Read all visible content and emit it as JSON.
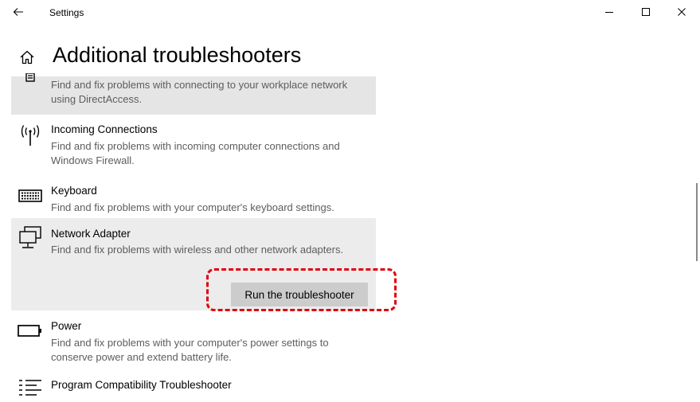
{
  "window": {
    "app_title": "Settings",
    "back_icon": "arrow-left-icon",
    "minimize_icon": "minimize-icon",
    "maximize_icon": "maximize-icon",
    "close_icon": "close-icon"
  },
  "header": {
    "home_icon": "home-icon",
    "page_title": "Additional troubleshooters"
  },
  "troubleshooters": [
    {
      "icon": "directaccess-icon",
      "title": "",
      "description": "Find and fix problems with connecting to your workplace network using DirectAccess.",
      "state": "hover"
    },
    {
      "icon": "antenna-icon",
      "title": "Incoming Connections",
      "description": "Find and fix problems with incoming computer connections and Windows Firewall."
    },
    {
      "icon": "keyboard-icon",
      "title": "Keyboard",
      "description": "Find and fix problems with your computer's keyboard settings."
    },
    {
      "icon": "network-adapter-icon",
      "title": "Network Adapter",
      "description": "Find and fix problems with wireless and other network adapters.",
      "state": "expanded",
      "action_label": "Run the troubleshooter"
    },
    {
      "icon": "battery-icon",
      "title": "Power",
      "description": "Find and fix problems with your computer's power settings to conserve power and extend battery life."
    },
    {
      "icon": "program-compatibility-icon",
      "title": "Program Compatibility Troubleshooter",
      "description": ""
    }
  ],
  "colors": {
    "hover_background": "#e5e5e5",
    "selected_background": "#ececec",
    "button_background": "#cccccc",
    "annotation_red": "#e0000b",
    "description_gray": "#5d5d5d"
  }
}
